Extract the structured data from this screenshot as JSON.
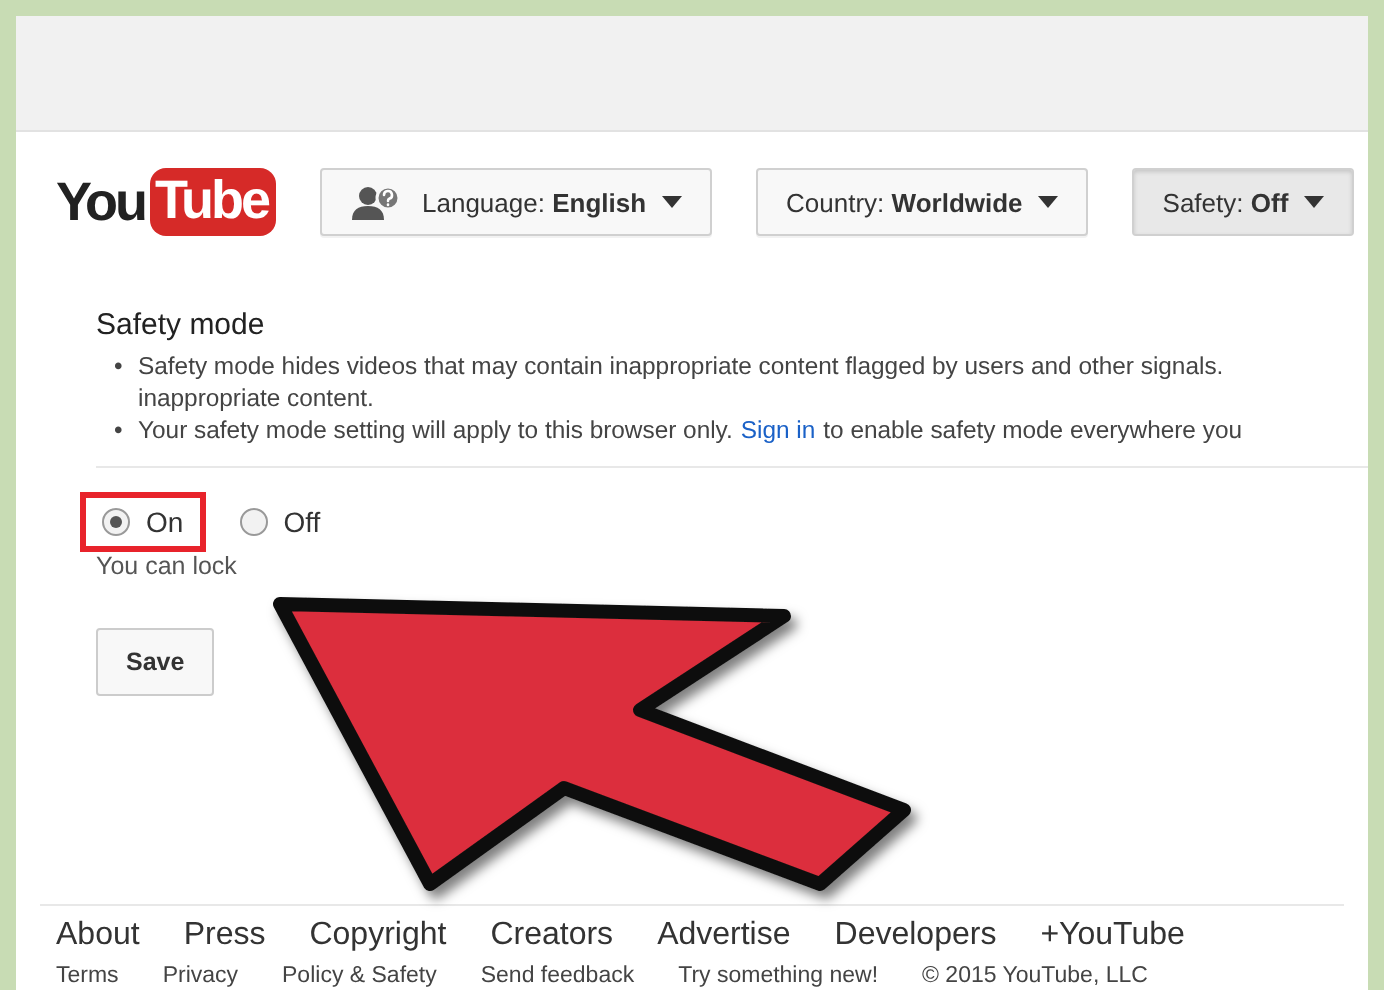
{
  "logo": {
    "left": "You",
    "right": "Tube"
  },
  "toolbar": [
    {
      "kind": "language",
      "label": "Language:",
      "value": "English"
    },
    {
      "kind": "plain",
      "label": "Country:",
      "value": "Worldwide"
    },
    {
      "kind": "pressed",
      "label": "Safety:",
      "value": "Off"
    }
  ],
  "safety": {
    "title": "Safety mode",
    "bullets": [
      {
        "marker": "•",
        "lines": [
          [
            {
              "kind": "text",
              "text": "Safety mode hides videos that may contain inappropriate content flagged by users and other signals."
            }
          ],
          [
            {
              "kind": "text",
              "text": "inappropriate content."
            }
          ]
        ]
      },
      {
        "marker": "•",
        "lines": [
          [
            {
              "kind": "text",
              "text": "Your safety mode setting will apply to this browser only."
            },
            {
              "kind": "link",
              "text": "Sign in"
            },
            {
              "kind": "text",
              "text": "to enable safety mode everywhere you"
            }
          ]
        ]
      }
    ],
    "options": [
      {
        "label": "On",
        "selected": true,
        "highlighted": true
      },
      {
        "label": "Off",
        "selected": false,
        "highlighted": false
      }
    ],
    "note": "You can lock",
    "save": "Save"
  },
  "footer": {
    "links": [
      "About",
      "Press",
      "Copyright",
      "Creators",
      "Advertise",
      "Developers",
      "+YouTube"
    ],
    "small": [
      "Terms",
      "Privacy",
      "Policy & Safety",
      "Send feedback",
      "Try something new!",
      "© 2015 YouTube, LLC"
    ]
  }
}
